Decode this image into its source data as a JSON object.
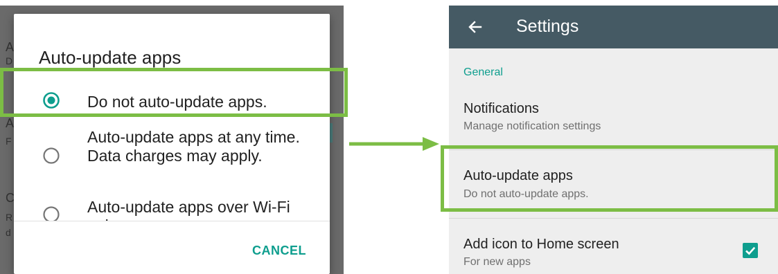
{
  "left": {
    "background_fragments": [
      "A",
      "D",
      "A",
      "F",
      "C",
      "R",
      "d"
    ],
    "dialog": {
      "title": "Auto-update apps",
      "options": [
        {
          "label": "Do not auto-update apps.",
          "selected": true
        },
        {
          "label": "Auto-update apps at any time. Data charges may apply.",
          "selected": false
        },
        {
          "label": "Auto-update apps over Wi-Fi only.",
          "selected": false
        }
      ],
      "cancel_label": "CANCEL"
    }
  },
  "right": {
    "appbar": {
      "title": "Settings",
      "back_icon": "arrow-left-icon"
    },
    "section_header": "General",
    "preferences": [
      {
        "title": "Notifications",
        "summary": "Manage notification settings"
      },
      {
        "title": "Auto-update apps",
        "summary": "Do not auto-update apps."
      },
      {
        "title": "Add icon to Home screen",
        "summary": "For new apps",
        "checked": true
      }
    ]
  },
  "colors": {
    "accent": "#0e9e8e",
    "appbar": "#455a64",
    "highlight": "#7cbd45",
    "dim_overlay": "#6a6a6a"
  }
}
